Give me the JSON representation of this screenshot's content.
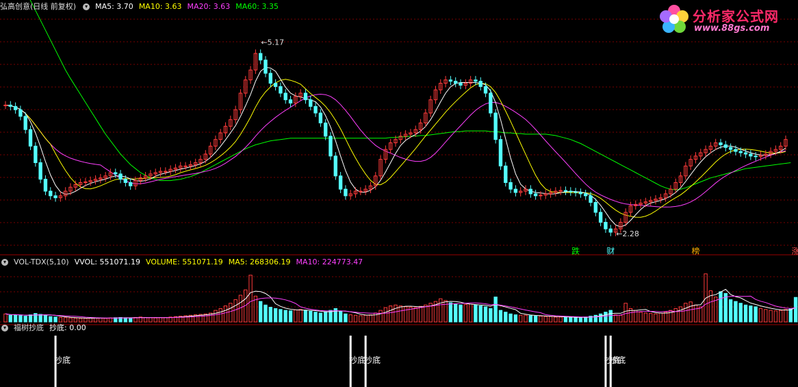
{
  "main_header": {
    "stock": "弘高创意(日线 前复权)",
    "ma5": "MA5: 3.70",
    "ma10": "MA10: 3.63",
    "ma20": "MA20: 3.63",
    "ma60": "MA60: 3.35"
  },
  "vol_header": {
    "indicator": "VOL-TDX(5,10)",
    "vvol": "VVOL: 551071.19",
    "volume": "VOLUME: 551071.19",
    "ma5": "MA5: 268306.19",
    "ma10": "MA10: 224773.47"
  },
  "sig_header": {
    "indicator": "福树抄底",
    "value": "抄底: 0.00"
  },
  "logo": {
    "name": "分析家公式网",
    "url": "www.88gs.com"
  },
  "colors": {
    "up": "#ff3b3b",
    "down": "#54ffff",
    "ma5": "#ffffff",
    "ma10": "#ffff00",
    "ma20": "#ff40ff",
    "ma60": "#00ff00",
    "grid": "#7a0000",
    "signal": "#ffffff"
  },
  "chart_data": [
    {
      "type": "candlestick",
      "title": "弘高创意(日线 前复权)",
      "ylim": [
        2.0,
        5.6
      ],
      "annotations": [
        {
          "label": "5.17",
          "kind": "high",
          "value": 5.17
        },
        {
          "label": "2.28",
          "kind": "low",
          "value": 2.28
        }
      ],
      "markers": [
        "跌",
        "财",
        "榜",
        "涨"
      ],
      "closes": [
        4.22,
        4.2,
        4.15,
        4.05,
        3.85,
        3.6,
        3.35,
        3.1,
        2.92,
        2.85,
        2.82,
        2.85,
        2.92,
        2.98,
        3.02,
        3.05,
        3.06,
        3.08,
        3.1,
        3.12,
        3.15,
        3.2,
        3.18,
        3.1,
        3.05,
        3.0,
        3.08,
        3.12,
        3.15,
        3.18,
        3.2,
        3.22,
        3.22,
        3.25,
        3.27,
        3.3,
        3.3,
        3.32,
        3.35,
        3.4,
        3.48,
        3.6,
        3.7,
        3.8,
        3.9,
        4.0,
        4.15,
        4.4,
        4.6,
        4.75,
        5.0,
        4.9,
        4.7,
        4.55,
        4.5,
        4.4,
        4.3,
        4.25,
        4.35,
        4.4,
        4.3,
        4.2,
        4.1,
        3.95,
        3.75,
        3.45,
        3.15,
        2.95,
        2.85,
        2.88,
        2.92,
        2.92,
        2.95,
        3.0,
        3.15,
        3.4,
        3.55,
        3.65,
        3.7,
        3.75,
        3.78,
        3.8,
        3.85,
        3.95,
        4.1,
        4.3,
        4.45,
        4.55,
        4.6,
        4.58,
        4.55,
        4.52,
        4.55,
        4.6,
        4.58,
        4.5,
        4.4,
        4.1,
        3.7,
        3.3,
        3.05,
        2.95,
        2.9,
        2.92,
        2.95,
        2.88,
        2.85,
        2.86,
        2.88,
        2.9,
        2.92,
        2.93,
        2.92,
        2.91,
        2.9,
        2.88,
        2.85,
        2.75,
        2.6,
        2.45,
        2.35,
        2.3,
        2.35,
        2.45,
        2.6,
        2.7,
        2.72,
        2.74,
        2.76,
        2.78,
        2.8,
        2.82,
        2.88,
        2.95,
        3.05,
        3.15,
        3.3,
        3.4,
        3.45,
        3.5,
        3.55,
        3.6,
        3.65,
        3.62,
        3.58,
        3.55,
        3.52,
        3.5,
        3.48,
        3.45,
        3.44,
        3.46,
        3.48,
        3.52,
        3.55,
        3.6,
        3.7
      ],
      "ma60": [
        6.55,
        6.4,
        6.25,
        6.1,
        5.95,
        5.8,
        5.65,
        5.5,
        5.35,
        5.2,
        5.05,
        4.9,
        4.75,
        4.62,
        4.5,
        4.38,
        4.26,
        4.14,
        4.02,
        3.9,
        3.78,
        3.68,
        3.58,
        3.48,
        3.4,
        3.32,
        3.26,
        3.2,
        3.16,
        3.12,
        3.1,
        3.08,
        3.08,
        3.08,
        3.09,
        3.1,
        3.12,
        3.14,
        3.17,
        3.2,
        3.24,
        3.28,
        3.32,
        3.36,
        3.4,
        3.44,
        3.48,
        3.52,
        3.56,
        3.59,
        3.62,
        3.64,
        3.66,
        3.68,
        3.69,
        3.7,
        3.71,
        3.72,
        3.72,
        3.72,
        3.72,
        3.72,
        3.72,
        3.72,
        3.72,
        3.72,
        3.72,
        3.72,
        3.72,
        3.72,
        3.72,
        3.72,
        3.72,
        3.72,
        3.72,
        3.72,
        3.72,
        3.73,
        3.73,
        3.74,
        3.74,
        3.75,
        3.75,
        3.76,
        3.76,
        3.77,
        3.78,
        3.79,
        3.8,
        3.81,
        3.82,
        3.82,
        3.83,
        3.83,
        3.83,
        3.83,
        3.83,
        3.82,
        3.82,
        3.81,
        3.8,
        3.8,
        3.79,
        3.79,
        3.78,
        3.78,
        3.78,
        3.78,
        3.78,
        3.77,
        3.76,
        3.74,
        3.72,
        3.7,
        3.67,
        3.64,
        3.6,
        3.56,
        3.52,
        3.48,
        3.44,
        3.4,
        3.36,
        3.32,
        3.28,
        3.24,
        3.2,
        3.16,
        3.12,
        3.08,
        3.04,
        3.0,
        2.97,
        2.95,
        2.94,
        2.95,
        2.97,
        3.0,
        3.03,
        3.06,
        3.09,
        3.12,
        3.14,
        3.16,
        3.18,
        3.2,
        3.22,
        3.24,
        3.26,
        3.27,
        3.28,
        3.29,
        3.3,
        3.31,
        3.32,
        3.33,
        3.34,
        3.35
      ]
    },
    {
      "type": "bar",
      "title": "VOL-TDX(5,10)",
      "ylim": [
        0,
        1200000
      ],
      "volumes": [
        180000,
        150000,
        160000,
        140000,
        130000,
        160000,
        190000,
        170000,
        150000,
        120000,
        110000,
        100000,
        95000,
        90000,
        85000,
        80000,
        80000,
        85000,
        90000,
        85000,
        80000,
        90000,
        95000,
        100000,
        95000,
        90000,
        100000,
        110000,
        100000,
        95000,
        90000,
        95000,
        100000,
        110000,
        120000,
        130000,
        140000,
        150000,
        160000,
        170000,
        180000,
        200000,
        260000,
        300000,
        360000,
        420000,
        500000,
        600000,
        720000,
        1050000,
        580000,
        460000,
        380000,
        330000,
        300000,
        280000,
        260000,
        250000,
        270000,
        280000,
        260000,
        240000,
        220000,
        200000,
        230000,
        260000,
        300000,
        240000,
        180000,
        160000,
        150000,
        140000,
        150000,
        160000,
        200000,
        260000,
        320000,
        360000,
        380000,
        360000,
        340000,
        330000,
        320000,
        350000,
        380000,
        420000,
        460000,
        520000,
        480000,
        430000,
        400000,
        380000,
        390000,
        400000,
        380000,
        360000,
        340000,
        300000,
        560000,
        260000,
        220000,
        180000,
        160000,
        150000,
        150000,
        140000,
        130000,
        130000,
        120000,
        120000,
        110000,
        110000,
        110000,
        100000,
        100000,
        100000,
        110000,
        130000,
        150000,
        180000,
        220000,
        260000,
        160000,
        150000,
        420000,
        300000,
        260000,
        220000,
        200000,
        190000,
        180000,
        200000,
        220000,
        260000,
        300000,
        340000,
        420000,
        450000,
        380000,
        340000,
        1080000,
        700000,
        560000,
        680000,
        640000,
        500000,
        460000,
        420000,
        380000,
        360000,
        340000,
        300000,
        280000,
        260000,
        250000,
        260000,
        280000,
        300000,
        551071
      ],
      "ma5": 268306.19,
      "ma10": 224773.47
    },
    {
      "type": "line",
      "title": "福树抄底",
      "ylim": [
        0,
        1
      ],
      "signals": [
        {
          "index": 10,
          "label": "抄底"
        },
        {
          "index": 69,
          "label": "抄底"
        },
        {
          "index": 72,
          "label": "抄底"
        },
        {
          "index": 120,
          "label": "抄底"
        },
        {
          "index": 121,
          "label": "抄底"
        }
      ]
    }
  ]
}
